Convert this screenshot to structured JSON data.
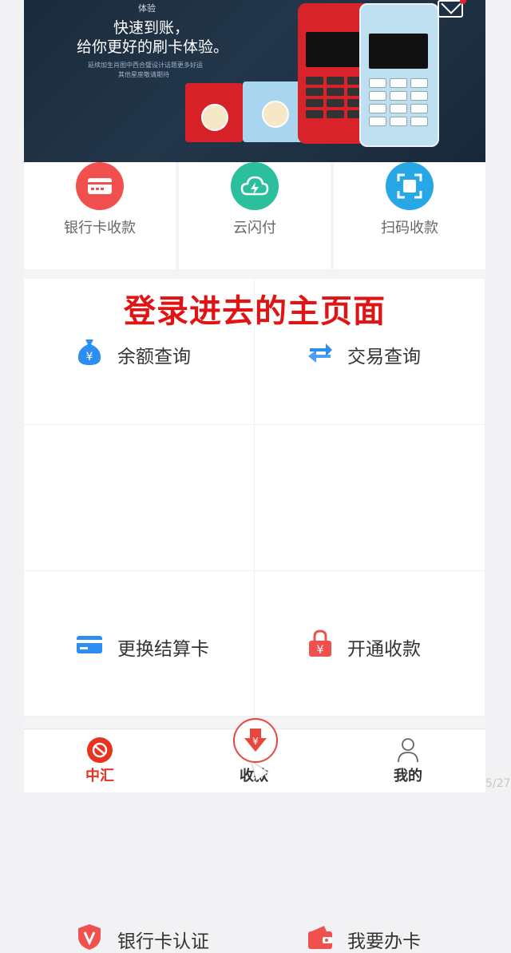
{
  "banner": {
    "small_text": "体验",
    "line1": "快速到账，",
    "line2": "给你更好的刷卡体验。",
    "note1": "延续加生肖图中西合璧设计话题更多好运",
    "note2": "其他星座敬请期待"
  },
  "quick_actions": [
    {
      "label": "银行卡收款",
      "color": "#f0514e"
    },
    {
      "label": "云闪付",
      "color": "#2bbf9e"
    },
    {
      "label": "扫码收款",
      "color": "#27a7e6"
    }
  ],
  "overlay_title": "登录进去的主页面",
  "menu": [
    {
      "label": "余额查询",
      "icon": "money-bag-icon",
      "color": "#2d8ef2"
    },
    {
      "label": "交易查询",
      "icon": "exchange-arrows-icon",
      "color": "#2d8ef2"
    },
    {
      "label": "更换结算卡",
      "icon": "card-icon",
      "color": "#2d8ef2"
    },
    {
      "label": "开通收款",
      "icon": "lock-yuan-icon",
      "color": "#f0514e"
    },
    {
      "label": "银行卡认证",
      "icon": "shield-v-icon",
      "color": "#f0514e"
    },
    {
      "label": "我要办卡",
      "icon": "wallet-icon",
      "color": "#f0514e"
    }
  ],
  "nav": {
    "home_label": "中汇",
    "center_label": "收款",
    "mine_label": "我的",
    "active_color": "#e8331f"
  },
  "page_number": "5/27"
}
